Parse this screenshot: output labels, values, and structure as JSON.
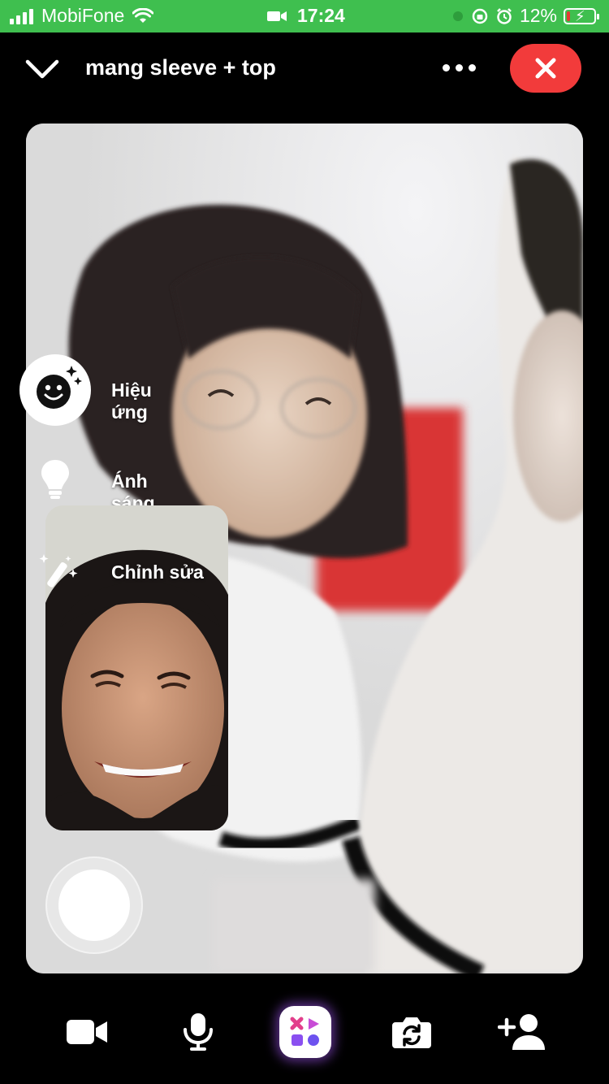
{
  "status_bar": {
    "carrier": "MobiFone",
    "time": "17:24",
    "battery_percent": "12%",
    "battery_level": 0.12,
    "background_color": "#3fbf4f"
  },
  "top_bar": {
    "title": "mang sleeve + top",
    "collapse_icon": "chevron-down-icon",
    "more_icon": "more-horizontal-icon",
    "end_call_icon": "close-icon",
    "end_call_color": "#f23b3b"
  },
  "side_menu": {
    "items": [
      {
        "label": "Hiệu ứng",
        "icon": "smiley-sparkle-icon"
      },
      {
        "label": "Ánh sáng",
        "icon": "lightbulb-icon"
      },
      {
        "label": "Chỉnh sửa",
        "icon": "magic-wand-icon"
      }
    ]
  },
  "bottom_bar": {
    "buttons": [
      {
        "name": "video-camera",
        "icon": "video-camera-icon"
      },
      {
        "name": "microphone",
        "icon": "microphone-icon"
      },
      {
        "name": "activities",
        "icon": "apps-icon"
      },
      {
        "name": "flip-camera",
        "icon": "camera-flip-icon"
      },
      {
        "name": "add-person",
        "icon": "add-person-icon"
      }
    ]
  }
}
